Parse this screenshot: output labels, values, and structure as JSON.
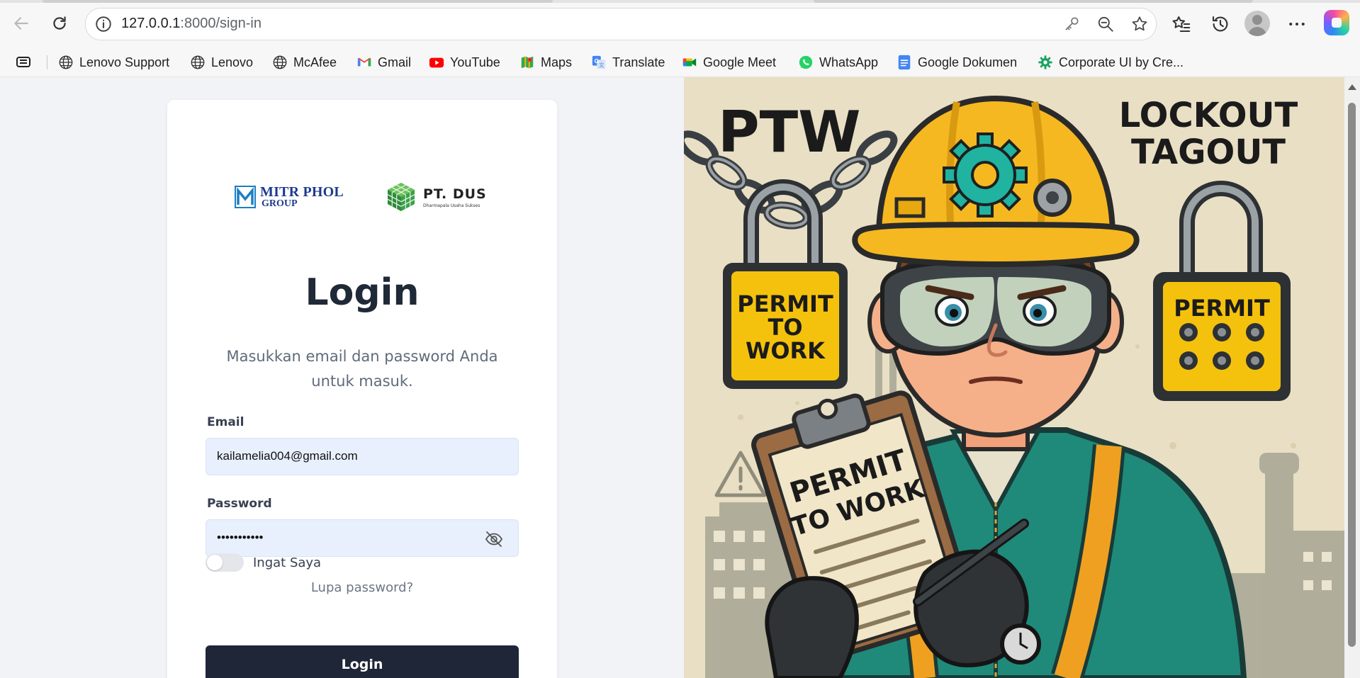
{
  "browser": {
    "url_host": "127.0.0.1",
    "url_path": ":8000/sign-in"
  },
  "bookmarks": [
    {
      "label": "Lenovo Support",
      "icon": "globe-icon"
    },
    {
      "label": "Lenovo",
      "icon": "globe-icon"
    },
    {
      "label": "McAfee",
      "icon": "globe-icon"
    },
    {
      "label": "Gmail",
      "icon": "gmail-icon"
    },
    {
      "label": "YouTube",
      "icon": "youtube-icon"
    },
    {
      "label": "Maps",
      "icon": "maps-icon"
    },
    {
      "label": "Translate",
      "icon": "translate-icon"
    },
    {
      "label": "Google Meet",
      "icon": "meet-icon"
    },
    {
      "label": "WhatsApp",
      "icon": "whatsapp-icon"
    },
    {
      "label": "Google Dokumen",
      "icon": "docs-icon"
    },
    {
      "label": "Corporate UI by Cre...",
      "icon": "gear-green-icon"
    }
  ],
  "logos": {
    "mitr_line1": "MITR PHOL",
    "mitr_line2": "GROUP",
    "dus_name": "PT. DUS",
    "dus_tagline": "Dharmapala Usaha Sukses"
  },
  "login": {
    "title": "Login",
    "subtitle": "Masukkan email dan password Anda untuk masuk.",
    "email_label": "Email",
    "email_value": "kailamelia004@gmail.com",
    "password_label": "Password",
    "password_value": "•••••••••••",
    "remember_label": "Ingat Saya",
    "remember_checked": false,
    "forgot_label": "Lupa password?",
    "button_label": "Login"
  },
  "illustration": {
    "heading_left": "PTW",
    "heading_right_line1": "LOCKOUT",
    "heading_right_line2": "TAGOUT",
    "lock_left_line1": "PERMIT",
    "lock_left_line2": "TO",
    "lock_left_line3": "WORK",
    "lock_right_label": "PERMIT",
    "clipboard_line1": "PERMIT",
    "clipboard_line2": "TO WORK"
  },
  "colors": {
    "primary_button": "#1e2637",
    "input_bg": "#e8f0fe",
    "helmet_yellow": "#f5b820",
    "uniform_teal": "#1f8a7a"
  }
}
